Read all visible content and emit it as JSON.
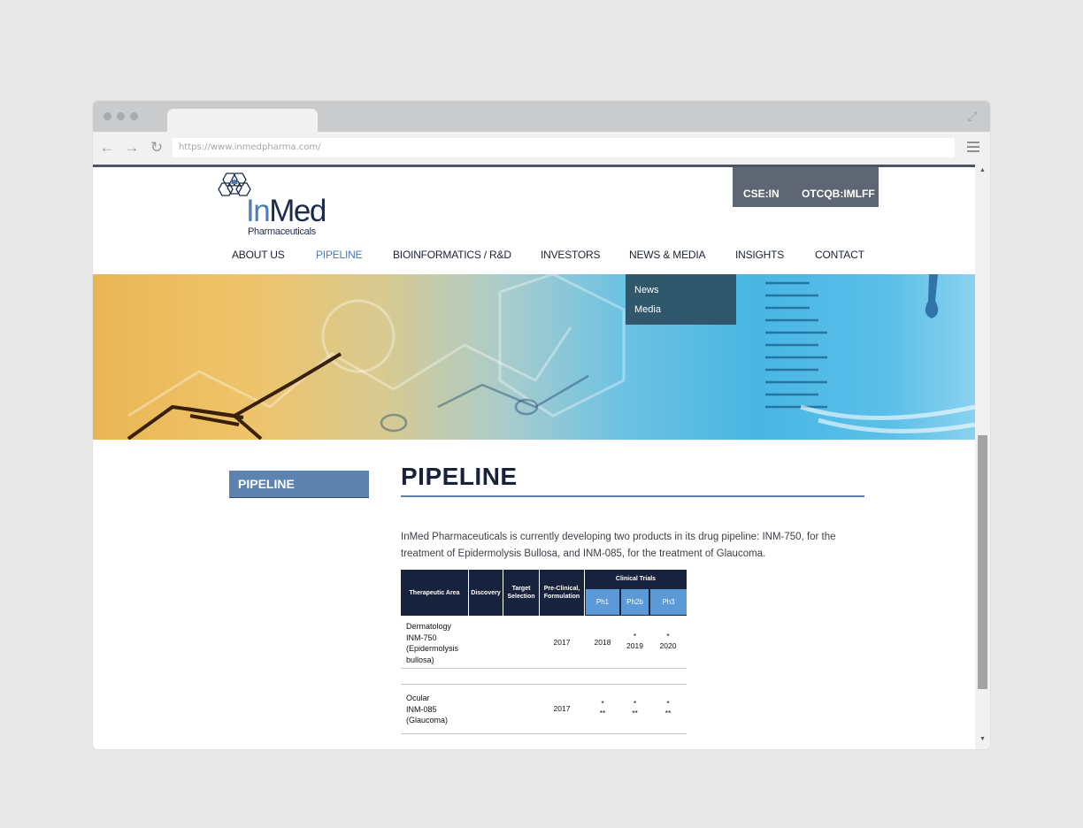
{
  "browser": {
    "url": "https://www.inmedpharma.com/"
  },
  "site": {
    "logo": {
      "word_in": "In",
      "word_med": "Med",
      "subtitle": "Pharmaceuticals"
    },
    "tickers": [
      "CSE:IN",
      "OTCQB:IMLFF"
    ],
    "nav": [
      {
        "label": "ABOUT US",
        "active": false
      },
      {
        "label": "PIPELINE",
        "active": true
      },
      {
        "label": "BIOINFORMATICS / R&D",
        "active": false
      },
      {
        "label": "INVESTORS",
        "active": false
      },
      {
        "label": "NEWS & MEDIA",
        "active": false
      },
      {
        "label": "INSIGHTS",
        "active": false
      },
      {
        "label": "CONTACT",
        "active": false
      }
    ],
    "dropdown": [
      "News",
      "Media"
    ]
  },
  "sidebar": {
    "label": "PIPELINE"
  },
  "main": {
    "title": "PIPELINE",
    "intro": "InMed Pharmaceuticals is currently developing two products in its drug pipeline: INM-750, for the treatment of Epidermolysis Bullosa, and INM-085, for the treatment of Glaucoma.",
    "table": {
      "headers": {
        "therapeutic_area": "Therapeutic Area",
        "discovery": "Discovery",
        "target_selection": "Target Selection",
        "preclinical": "Pre-Clinical, Formulation",
        "clinical_trials": "Clinical Trials",
        "ph1": "Ph1",
        "ph2b": "Ph2b",
        "ph3": "Ph3"
      },
      "rows": [
        {
          "area_lines": [
            "Dermatology",
            "INM-750",
            "(Epidermolysis",
            "bullosa)"
          ],
          "preclinical": "2017",
          "ph1": "2018",
          "ph2b_mark": "*",
          "ph2b": "2019",
          "ph3_mark": "*",
          "ph3": "2020"
        },
        {
          "area_lines": [
            "Ocular",
            "INM-085",
            "(Glaucoma)"
          ],
          "preclinical": "2017",
          "ph1_mark": "*",
          "ph1": "**",
          "ph2b_mark": "*",
          "ph2b": "**",
          "ph3_mark": "*",
          "ph3": "**"
        }
      ]
    }
  },
  "colors": {
    "accent_blue": "#4a79b0",
    "navy": "#17233c",
    "sidebar": "#5d83ae",
    "ticker_bg": "#5f6673"
  }
}
